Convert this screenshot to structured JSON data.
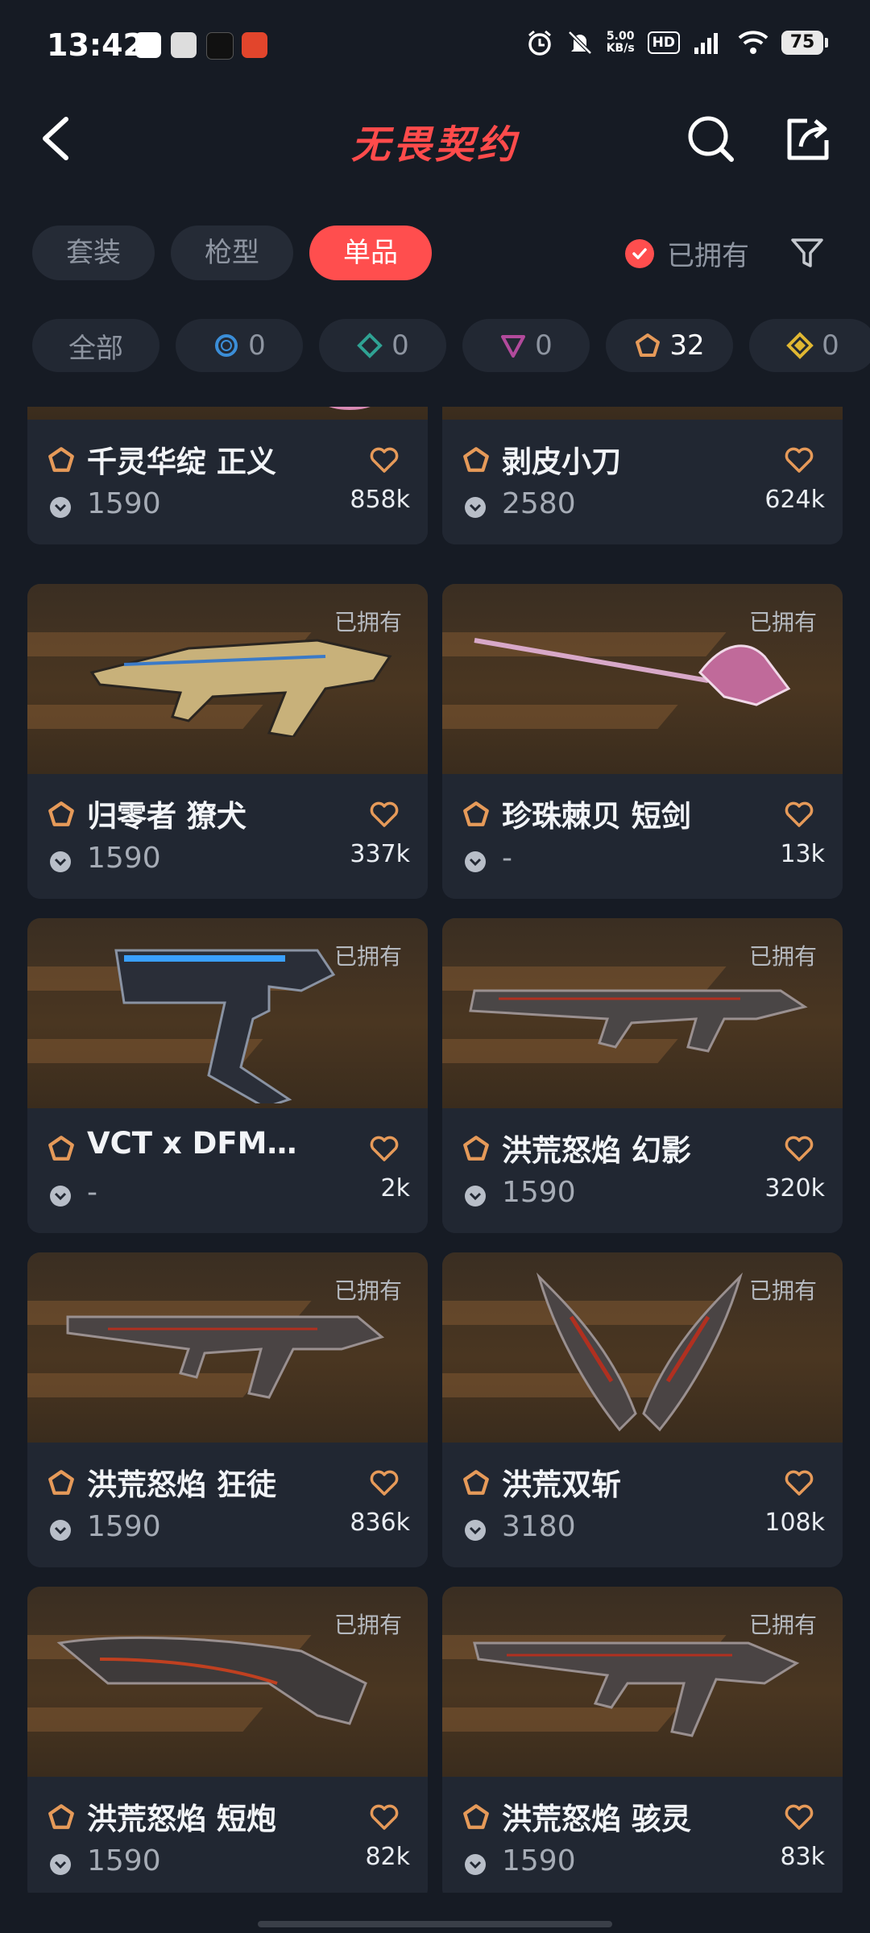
{
  "status_bar": {
    "time": "13:42",
    "net_speed_top": "5.00",
    "net_speed_bottom": "KB/s",
    "hd": "HD",
    "signal": "5G",
    "battery": "75"
  },
  "header": {
    "title": "无畏契约"
  },
  "tabs": [
    {
      "label": "套装"
    },
    {
      "label": "枪型"
    },
    {
      "label": "单品",
      "active": true
    }
  ],
  "owned_filter": {
    "label": "已拥有",
    "checked": true
  },
  "rarity_chips": [
    {
      "label": "全部"
    },
    {
      "count": "0",
      "color": "#3b8ed8"
    },
    {
      "count": "0",
      "color": "#2fa293"
    },
    {
      "count": "0",
      "color": "#b24a9c"
    },
    {
      "count": "32",
      "color": "#e69a59"
    },
    {
      "count": "0",
      "color": "#e0b732"
    }
  ],
  "cards": [
    {
      "name": "千灵华绽 正义",
      "price": "1590",
      "likes": "858k",
      "owned": "",
      "partial": true
    },
    {
      "name": "剥皮小刀",
      "price": "2580",
      "likes": "624k",
      "owned": "",
      "partial": true
    },
    {
      "name": "归零者 獠犬",
      "price": "1590",
      "likes": "337k",
      "owned": "已拥有"
    },
    {
      "name": "珍珠棘贝 短剑",
      "price": "-",
      "likes": "13k",
      "owned": "已拥有"
    },
    {
      "name": "VCT x DFM…",
      "price": "-",
      "likes": "2k",
      "owned": "已拥有"
    },
    {
      "name": "洪荒怒焰 幻影",
      "price": "1590",
      "likes": "320k",
      "owned": "已拥有"
    },
    {
      "name": "洪荒怒焰 狂徒",
      "price": "1590",
      "likes": "836k",
      "owned": "已拥有"
    },
    {
      "name": "洪荒双斩",
      "price": "3180",
      "likes": "108k",
      "owned": "已拥有"
    },
    {
      "name": "洪荒怒焰 短炮",
      "price": "1590",
      "likes": "82k",
      "owned": "已拥有"
    },
    {
      "name": "洪荒怒焰 骇灵",
      "price": "1590",
      "likes": "83k",
      "owned": "已拥有"
    }
  ],
  "colors": {
    "accent": "#ff4e4e",
    "rarity_premium": "#e69a59",
    "background": "#161b24",
    "card": "#212732"
  }
}
